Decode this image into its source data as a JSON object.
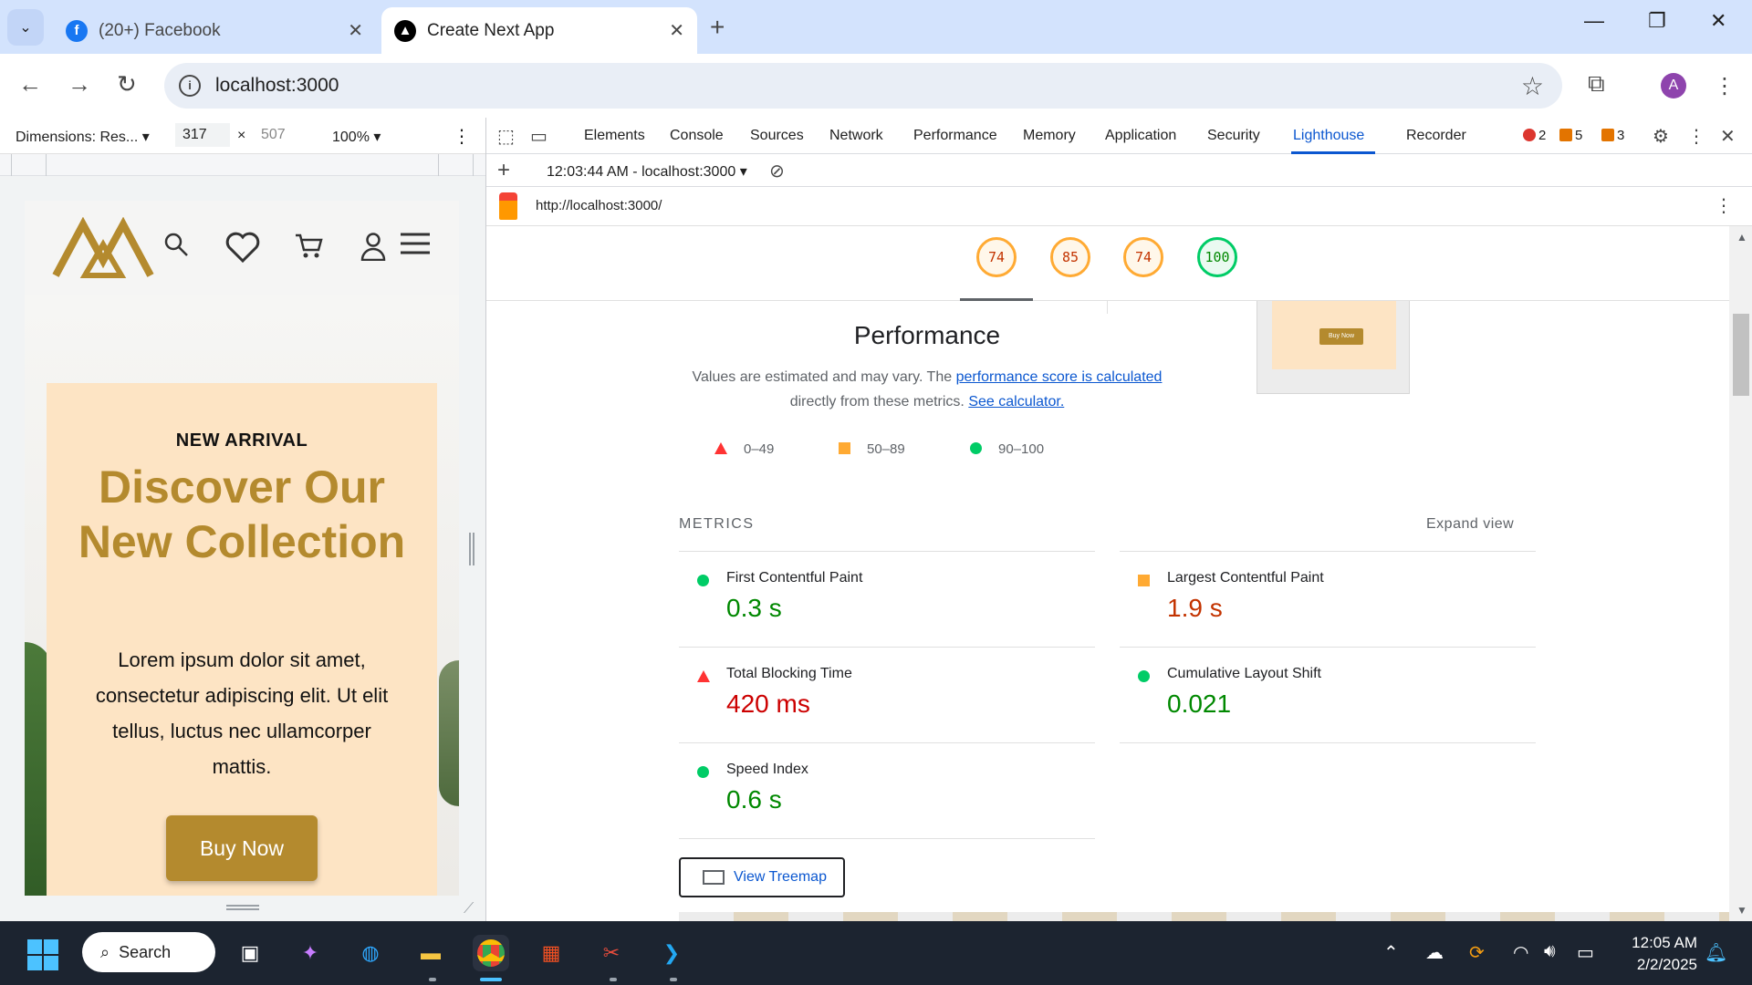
{
  "browser": {
    "tabs": [
      {
        "title": "(20+) Facebook",
        "icon": "facebook-icon",
        "active": false
      },
      {
        "title": "Create Next App",
        "icon": "nextjs-icon",
        "active": true
      }
    ],
    "address": "localhost:3000",
    "profile_initial": "A"
  },
  "device_toolbar": {
    "dimensions_label": "Dimensions: Res...",
    "width": "317",
    "times": "×",
    "height_placeholder": "507",
    "zoom": "100%"
  },
  "page": {
    "eyebrow": "NEW ARRIVAL",
    "headline": "Discover Our New Collection",
    "body": "Lorem ipsum dolor sit amet, consectetur adipiscing elit. Ut elit tellus, luctus nec ullamcorper mattis.",
    "cta": "Buy Now",
    "brand_color": "#b48a2e",
    "card_color": "#fde4c4"
  },
  "devtools": {
    "tabs": [
      "Elements",
      "Console",
      "Sources",
      "Network",
      "Performance",
      "Memory",
      "Application",
      "Security",
      "Lighthouse",
      "Recorder"
    ],
    "active_tab": "Lighthouse",
    "errors": "2",
    "warnings": "5",
    "issues": "3",
    "report_selector": "12:03:44 AM - localhost:3000",
    "report_url": "http://localhost:3000/"
  },
  "lighthouse": {
    "scores": [
      "74",
      "85",
      "74",
      "100"
    ],
    "section_title": "Performance",
    "desc_prefix": "Values are estimated and may vary. The ",
    "desc_link": "performance score is calculated",
    "desc_mid": " directly from these metrics. ",
    "desc_link2": "See calculator.",
    "legend": [
      "0–49",
      "50–89",
      "90–100"
    ],
    "metrics_title": "METRICS",
    "expand_label": "Expand view",
    "metrics": [
      {
        "name": "First Contentful Paint",
        "value": "0.3 s",
        "rating": "pass"
      },
      {
        "name": "Largest Contentful Paint",
        "value": "1.9 s",
        "rating": "average"
      },
      {
        "name": "Total Blocking Time",
        "value": "420 ms",
        "rating": "fail"
      },
      {
        "name": "Cumulative Layout Shift",
        "value": "0.021",
        "rating": "pass"
      },
      {
        "name": "Speed Index",
        "value": "0.6 s",
        "rating": "pass"
      }
    ],
    "treemap_label": "View Treemap",
    "thumb_text": "Buy Now"
  },
  "taskbar": {
    "search_label": "Search",
    "time": "12:05 AM",
    "date": "2/2/2025"
  }
}
